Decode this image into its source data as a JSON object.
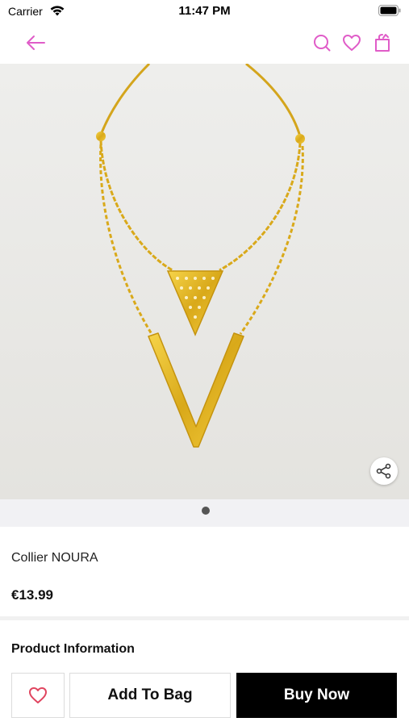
{
  "status_bar": {
    "carrier": "Carrier",
    "time": "11:47 PM",
    "wifi_icon": "wifi-icon",
    "battery_icon": "battery-icon"
  },
  "nav": {
    "back_icon": "arrow-left-icon",
    "search_icon": "search-icon",
    "wishlist_icon": "heart-icon",
    "bag_icon": "shopping-bag-icon",
    "accent_color": "#e05cc8"
  },
  "gallery": {
    "image_count": 1,
    "active_index": 0,
    "share_icon": "share-icon"
  },
  "product": {
    "name": "Collier NOURA",
    "price": "€13.99"
  },
  "sections": {
    "info_title": "Product Information"
  },
  "actions": {
    "wishlist_icon": "heart-icon",
    "wishlist_color": "#e0455f",
    "add_to_bag": "Add To Bag",
    "buy_now": "Buy Now"
  }
}
